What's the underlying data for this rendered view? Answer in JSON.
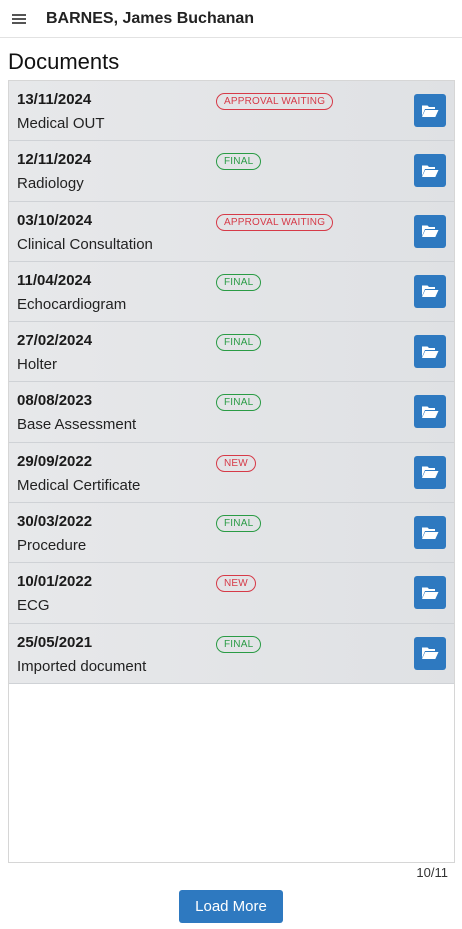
{
  "header": {
    "patient_name": "BARNES, James Buchanan",
    "menu_icon": "hamburger-menu-icon"
  },
  "page": {
    "title": "Documents"
  },
  "documents": [
    {
      "date": "13/11/2024",
      "type": "Medical OUT",
      "status": "APPROVAL WAITING",
      "status_color": "red"
    },
    {
      "date": "12/11/2024",
      "type": "Radiology",
      "status": "FINAL",
      "status_color": "green"
    },
    {
      "date": "03/10/2024",
      "type": "Clinical Consultation",
      "status": "APPROVAL WAITING",
      "status_color": "red"
    },
    {
      "date": "11/04/2024",
      "type": "Echocardiogram",
      "status": "FINAL",
      "status_color": "green"
    },
    {
      "date": "27/02/2024",
      "type": "Holter",
      "status": "FINAL",
      "status_color": "green"
    },
    {
      "date": "08/08/2023",
      "type": "Base Assessment",
      "status": "FINAL",
      "status_color": "green"
    },
    {
      "date": "29/09/2022",
      "type": "Medical Certificate",
      "status": "NEW",
      "status_color": "red"
    },
    {
      "date": "30/03/2022",
      "type": "Procedure",
      "status": "FINAL",
      "status_color": "green"
    },
    {
      "date": "10/01/2022",
      "type": "ECG",
      "status": "NEW",
      "status_color": "red"
    },
    {
      "date": "25/05/2021",
      "type": "Imported document",
      "status": "FINAL",
      "status_color": "green"
    }
  ],
  "footer": {
    "count": "10/11",
    "load_more_label": "Load More"
  },
  "colors": {
    "accent": "#2e79c0",
    "status_red": "#d63a48",
    "status_green": "#2a9b45"
  }
}
